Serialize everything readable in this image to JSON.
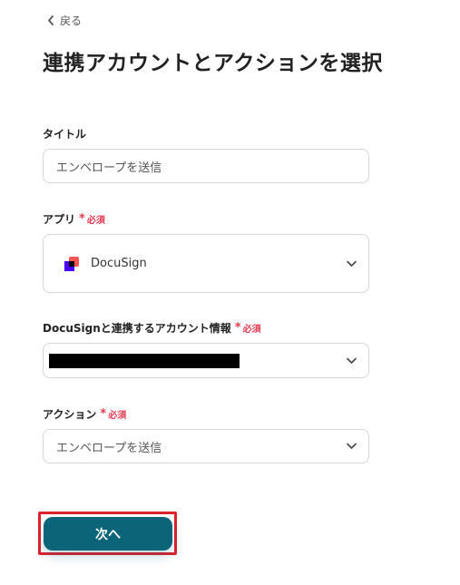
{
  "back": {
    "label": "戻る"
  },
  "page_title": "連携アカウントとアクションを選択",
  "required_text": "必須",
  "fields": {
    "title": {
      "label": "タイトル",
      "value": "エンベロープを送信"
    },
    "app": {
      "label": "アプリ",
      "value": "DocuSign",
      "icon": "docusign-logo"
    },
    "account": {
      "label": "DocuSignと連携するアカウント情報",
      "value": ""
    },
    "action": {
      "label": "アクション",
      "value": "エンベロープを送信"
    }
  },
  "next_button": {
    "label": "次へ"
  },
  "colors": {
    "required": "#e53950",
    "primary": "#0c6479",
    "highlight": "#e0202c"
  }
}
